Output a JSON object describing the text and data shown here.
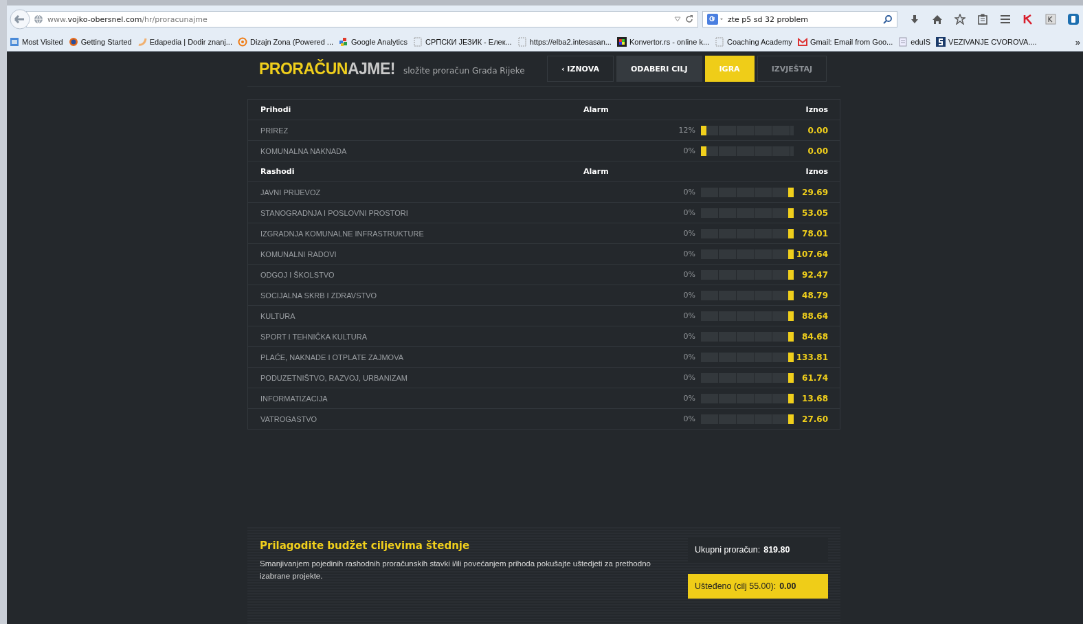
{
  "browser": {
    "url": "www.**vojko-obersnel.com**/hr/proracunajme",
    "search": {
      "value": "zte p5 sd 32 problem"
    },
    "bookmarks": [
      "Most Visited",
      "Getting Started",
      "Edapedia | Dodir znanj...",
      "Dizajn Zona (Powered ...",
      "Google Analytics",
      "СРПСКИ ЈЕЗИК - Елек...",
      "https://elba2.intesasan...",
      "Konvertor.rs - online k...",
      "Coaching Academy",
      "Gmail: Email from Goo...",
      "eduIS",
      "VEZIVANJE CVOROVA...."
    ],
    "overflow": "»"
  },
  "app": {
    "logo": {
      "part_1": "PRORAČUN",
      "part_2": "AJME!"
    },
    "tagline": "složite proračun Grada Rijeke",
    "nav": [
      {
        "label": "‹ IZNOVA",
        "selected": false,
        "completed": false
      },
      {
        "label": "ODABERI CILJ",
        "selected": false,
        "completed": true
      },
      {
        "label": "IGRA",
        "selected": true,
        "completed": false
      },
      {
        "label": "IZVJEŠTAJ",
        "selected": false,
        "completed": false
      }
    ],
    "sections": [
      {
        "title": "Prihodi",
        "alarm_heading": "Alarm",
        "amount_heading": "Iznos",
        "rows": [
          {
            "name": "PRIREZ",
            "alarm": "12%",
            "level": 0,
            "amount": "0.00"
          },
          {
            "name": "KOMUNALNA NAKNADA",
            "alarm": "0%",
            "level": 0,
            "amount": "0.00"
          }
        ]
      },
      {
        "title": "Rashodi",
        "alarm_heading": "Alarm",
        "amount_heading": "Iznos",
        "rows": [
          {
            "name": "JAVNI PRIJEVOZ",
            "alarm": "0%",
            "level": 1,
            "amount": "29.69"
          },
          {
            "name": "STANOGRADNJA I POSLOVNI PROSTORI",
            "alarm": "0%",
            "level": 1,
            "amount": "53.05"
          },
          {
            "name": "IZGRADNJA KOMUNALNE INFRASTRUKTURE",
            "alarm": "0%",
            "level": 1,
            "amount": "78.01"
          },
          {
            "name": "KOMUNALNI RADOVI",
            "alarm": "0%",
            "level": 1,
            "amount": "107.64"
          },
          {
            "name": "ODGOJ I ŠKOLSTVO",
            "alarm": "0%",
            "level": 1,
            "amount": "92.47"
          },
          {
            "name": "SOCIJALNA SKRB I ZDRAVSTVO",
            "alarm": "0%",
            "level": 1,
            "amount": "48.79"
          },
          {
            "name": "KULTURA",
            "alarm": "0%",
            "level": 1,
            "amount": "88.64"
          },
          {
            "name": "SPORT I TEHNIČKA KULTURA",
            "alarm": "0%",
            "level": 1,
            "amount": "84.68"
          },
          {
            "name": "PLAĆE, NAKNADE I OTPLATE ZAJMOVA",
            "alarm": "0%",
            "level": 1,
            "amount": "133.81"
          },
          {
            "name": "PODUZETNIŠTVO, RAZVOJ, URBANIZAM",
            "alarm": "0%",
            "level": 1,
            "amount": "61.74"
          },
          {
            "name": "INFORMATIZACIJA",
            "alarm": "0%",
            "level": 1,
            "amount": "13.68"
          },
          {
            "name": "VATROGASTVO",
            "alarm": "0%",
            "level": 1,
            "amount": "27.60"
          }
        ]
      }
    ],
    "footer": {
      "heading": "Prilagodite budžet ciljevima štednje",
      "text": "Smanjivanjem pojedinih rashodnih proračunskih stavki i/ili povećanjem prihoda pokušajte uštedjeti za prethodno izabrane projekte.",
      "total": {
        "label": "Ukupni proračun:",
        "value": "819.80"
      },
      "saved": {
        "label": "Ušteđeno (cilj 55.00):",
        "value": "0.00"
      }
    }
  }
}
